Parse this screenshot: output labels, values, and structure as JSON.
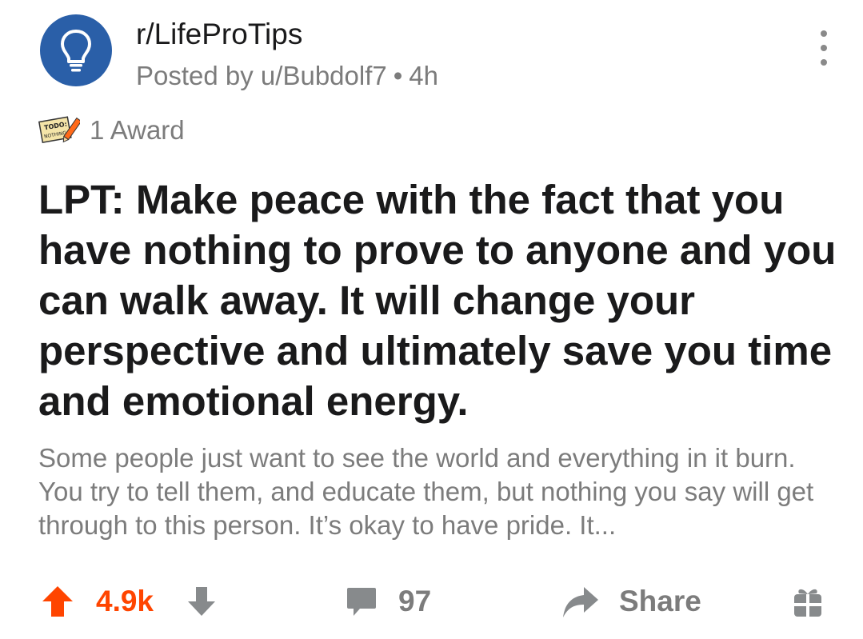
{
  "post": {
    "subreddit": "r/LifeProTips",
    "posted_by": "Posted by u/Bubdolf7",
    "separator": "•",
    "age": "4h",
    "subreddit_icon": "lightbulb-icon",
    "award_icon_text": "TODO: NOTHING",
    "award_count": "1 Award",
    "title": "LPT: Make peace with the fact that you have nothing to prove to anyone and you can walk away. It will change your perspective and ultimately save you time and emotional energy.",
    "body_preview": "Some people just want to see the world and everything in it burn. You try to tell them, and educate them, but nothing you say will get through to this person.  It’s okay to have pride. It..."
  },
  "actions": {
    "score": "4.9k",
    "comments": "97",
    "share_label": "Share"
  },
  "colors": {
    "upvote": "#ff4500",
    "avatar_bg": "#2a5fa8",
    "muted": "#7c7c7c",
    "title": "#1a1a1b"
  }
}
